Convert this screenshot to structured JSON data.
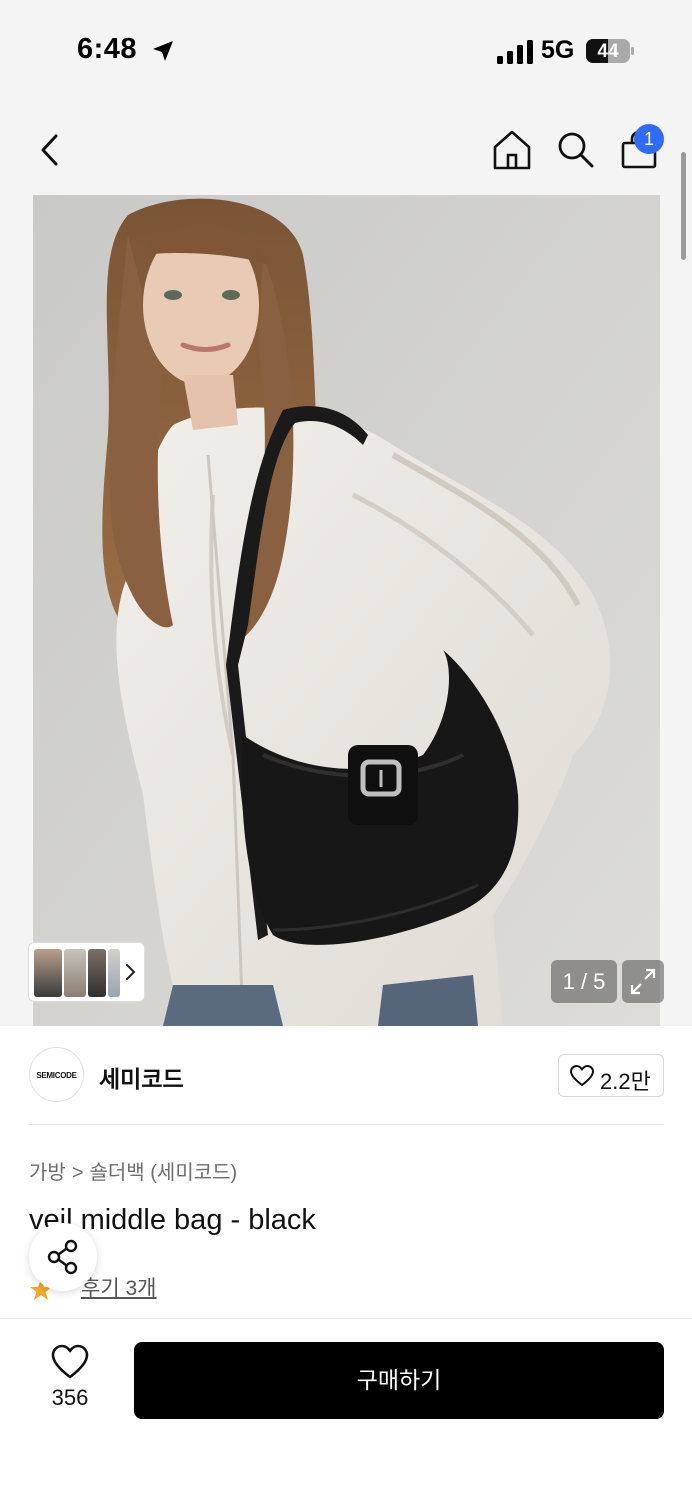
{
  "status_bar": {
    "time": "6:48",
    "network": "5G",
    "battery": "44"
  },
  "nav": {
    "cart_count": "1"
  },
  "gallery": {
    "counter": "1 / 5",
    "current_page": 1,
    "total_pages": 5
  },
  "brand": {
    "logo_text": "SEMICODE",
    "name": "세미코드",
    "like_count": "2.2만"
  },
  "breadcrumb": {
    "category": "가방",
    "separator": ">",
    "subcategory": "숄더백 (세미코드)"
  },
  "product": {
    "title": "veil middle bag - black",
    "review_dot": "·",
    "review_label": "후기 3개"
  },
  "bottom_bar": {
    "wish_count": "356",
    "buy_label": "구매하기"
  },
  "colors": {
    "badge": "#2f6cf6",
    "star": "#f5a623",
    "buy_button": "#000000"
  },
  "icons": [
    "back-icon",
    "home-icon",
    "search-icon",
    "shopping-bag-icon",
    "expand-icon",
    "heart-icon",
    "share-icon",
    "star-icon",
    "chevron-right-icon",
    "location-arrow-icon",
    "signal-icon",
    "battery-icon"
  ]
}
